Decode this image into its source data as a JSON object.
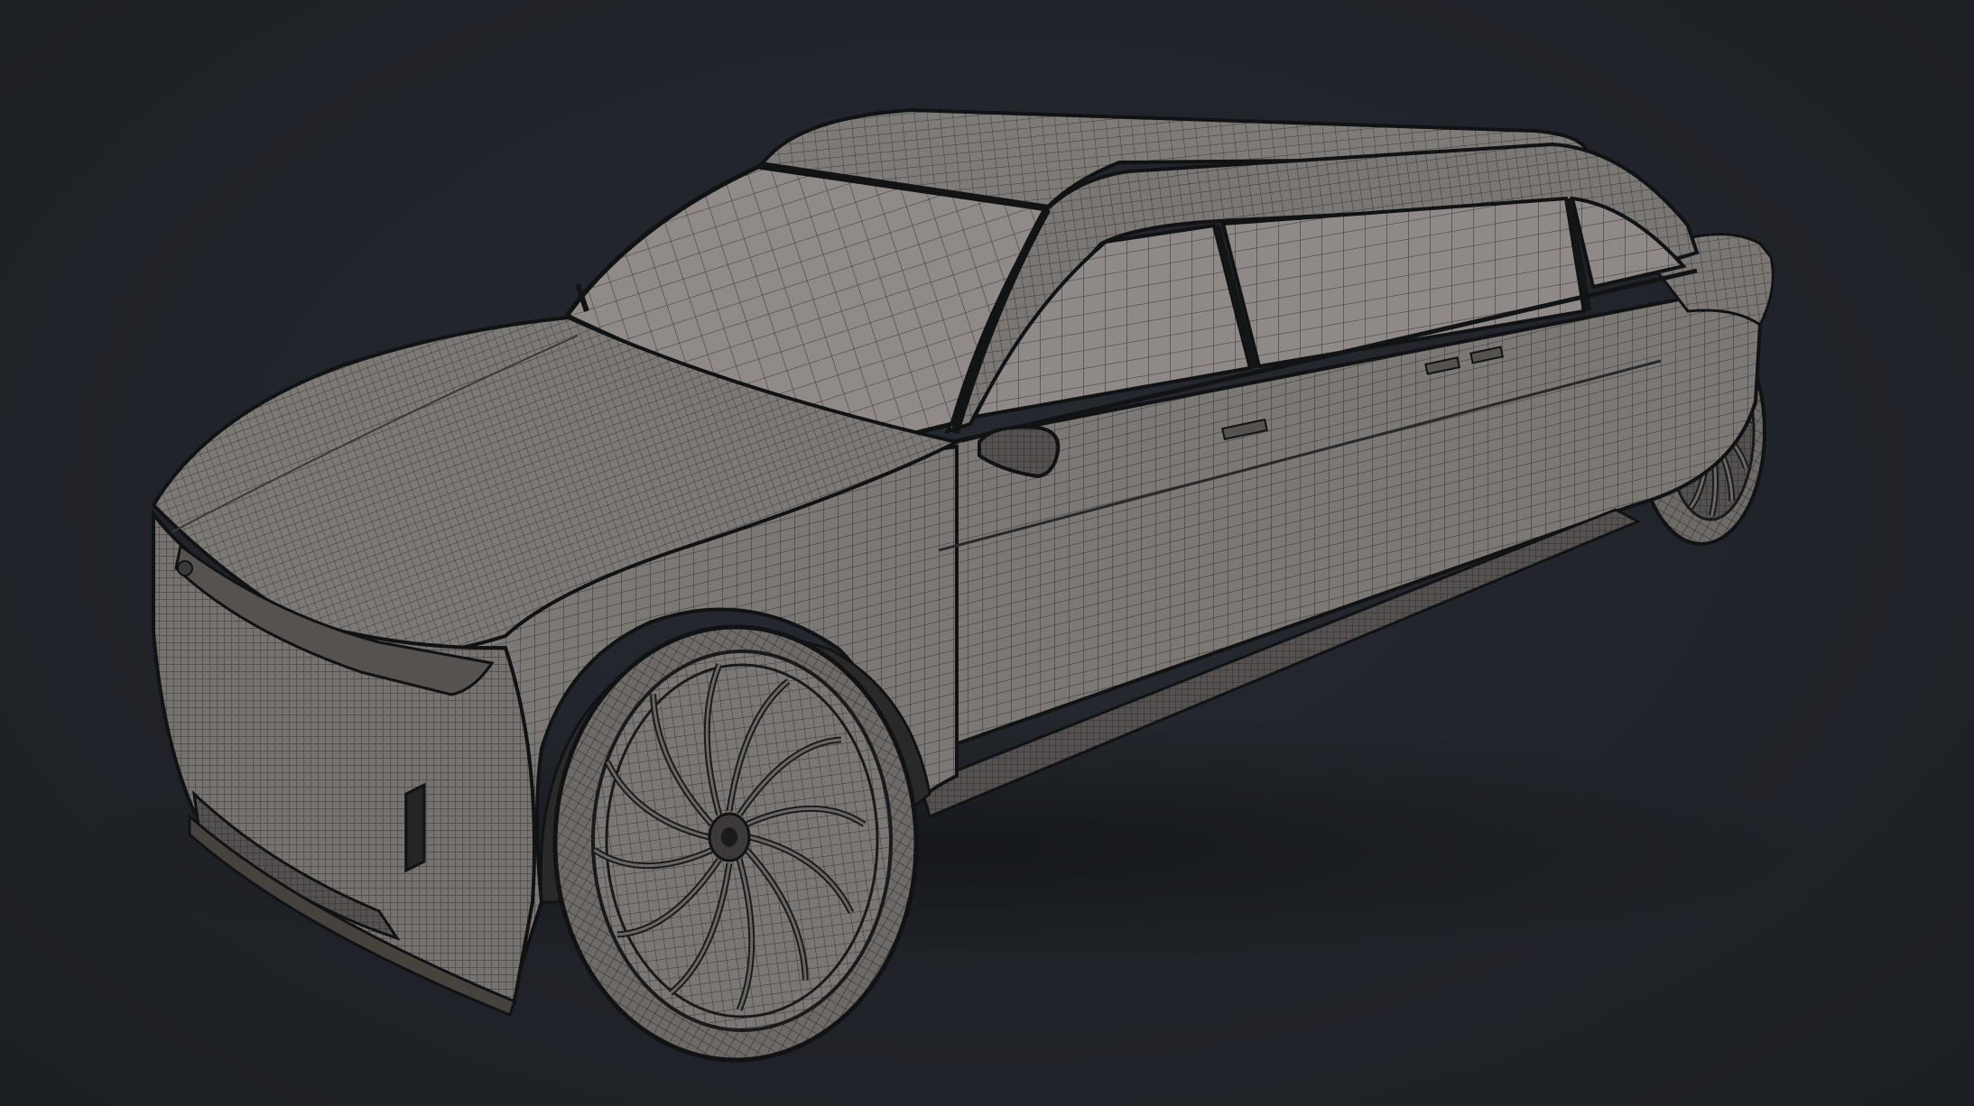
{
  "viewport": {
    "background_color": "#202329",
    "render_mode": "wireframe-on-shaded"
  },
  "model": {
    "type": "stretch limousine",
    "surface_color": "#7a7673",
    "glass_color": "#8e8886",
    "wire_color": "#2b2a2b",
    "outline_color": "#111214",
    "wheel_spokes": 12
  }
}
